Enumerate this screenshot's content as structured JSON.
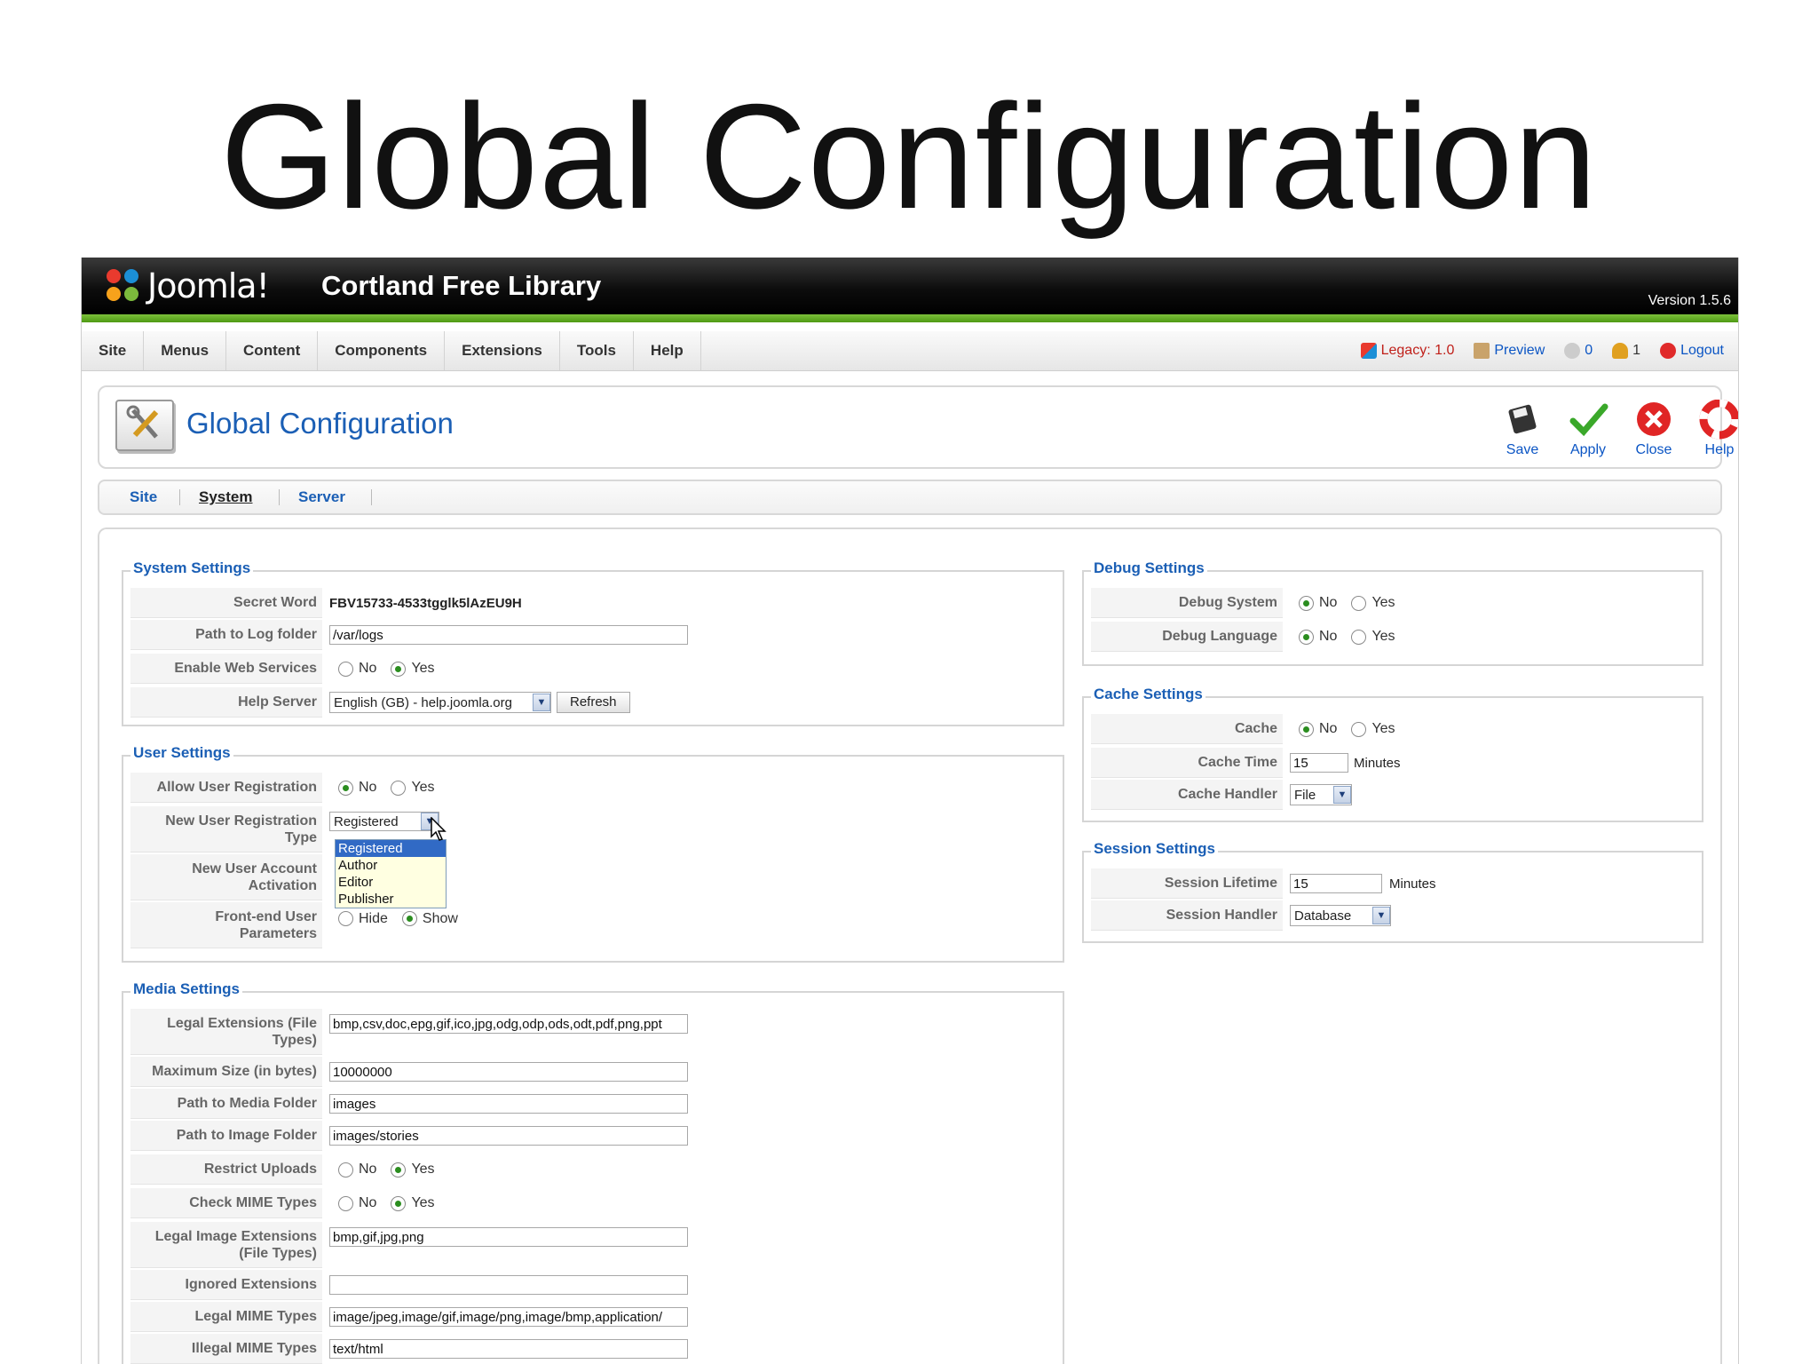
{
  "slide_title": "Global Configuration",
  "app": {
    "logo_text": "Joomla!",
    "site_name": "Cortland Free Library",
    "version": "Version 1.5.6"
  },
  "menu": [
    "Site",
    "Menus",
    "Content",
    "Components",
    "Extensions",
    "Tools",
    "Help"
  ],
  "status": {
    "legacy": "Legacy: 1.0",
    "preview": "Preview",
    "messages": "0",
    "users": "1",
    "logout": "Logout"
  },
  "header": {
    "title": "Global Configuration",
    "toolbar": [
      "Save",
      "Apply",
      "Close",
      "Help"
    ]
  },
  "subnav": {
    "tabs": [
      "Site",
      "System",
      "Server"
    ],
    "active": "System"
  },
  "system_settings": {
    "legend": "System Settings",
    "secret_word_label": "Secret Word",
    "secret_word": "FBV15733-4533tgglk5lAzEU9H",
    "log_path_label": "Path to Log folder",
    "log_path": "/var/logs",
    "web_services_label": "Enable Web Services",
    "help_server_label": "Help Server",
    "help_server": "English (GB) - help.joomla.org",
    "refresh": "Refresh"
  },
  "user_settings": {
    "legend": "User Settings",
    "allow_reg_label": "Allow User Registration",
    "new_type_label_1": "New User Registration",
    "new_type_label_2": "Type",
    "new_type_value": "Registered",
    "activation_label_1": "New User Account",
    "activation_label_2": "Activation",
    "frontend_label_1": "Front-end User",
    "frontend_label_2": "Parameters",
    "hide": "Hide",
    "show": "Show",
    "dropdown_options": [
      "Registered",
      "Author",
      "Editor",
      "Publisher"
    ]
  },
  "media_settings": {
    "legend": "Media Settings",
    "legal_ext_label_1": "Legal Extensions (File",
    "legal_ext_label_2": "Types)",
    "legal_ext": "bmp,csv,doc,epg,gif,ico,jpg,odg,odp,ods,odt,pdf,png,ppt",
    "max_size_label": "Maximum Size (in bytes)",
    "max_size": "10000000",
    "media_path_label": "Path to Media Folder",
    "media_path": "images",
    "image_path_label": "Path to Image Folder",
    "image_path": "images/stories",
    "restrict_label": "Restrict Uploads",
    "mime_check_label": "Check MIME Types",
    "legal_img_label_1": "Legal Image Extensions",
    "legal_img_label_2": "(File Types)",
    "legal_img": "bmp,gif,jpg,png",
    "ignored_label": "Ignored Extensions",
    "ignored": "",
    "legal_mime_label": "Legal MIME Types",
    "legal_mime": "image/jpeg,image/gif,image/png,image/bmp,application/",
    "illegal_mime_label": "Illegal MIME Types",
    "illegal_mime": "text/html"
  },
  "debug_settings": {
    "legend": "Debug Settings",
    "debug_system_label": "Debug System",
    "debug_language_label": "Debug Language"
  },
  "cache_settings": {
    "legend": "Cache Settings",
    "cache_label": "Cache",
    "cache_time_label": "Cache Time",
    "cache_time": "15",
    "minutes": "Minutes",
    "cache_handler_label": "Cache Handler",
    "cache_handler": "File"
  },
  "session_settings": {
    "legend": "Session Settings",
    "lifetime_label": "Session Lifetime",
    "lifetime": "15",
    "minutes": "Minutes",
    "handler_label": "Session Handler",
    "handler": "Database"
  },
  "radio_labels": {
    "no": "No",
    "yes": "Yes"
  }
}
